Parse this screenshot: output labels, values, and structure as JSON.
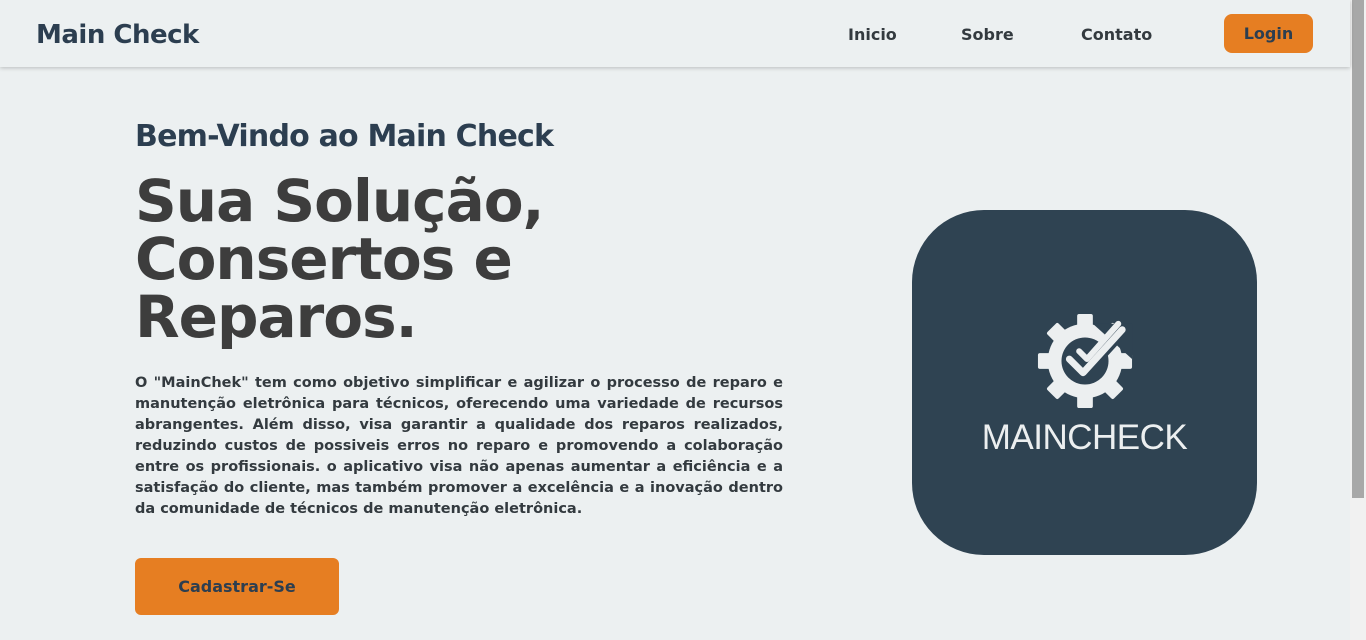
{
  "header": {
    "brand": "Main Check",
    "nav": [
      "Inicio",
      "Sobre",
      "Contato"
    ],
    "login_label": "Login"
  },
  "hero": {
    "welcome": "Bem-Vindo ao Main Check",
    "headline_lines": [
      "Sua Solução,",
      "Consertos e",
      "Reparos."
    ],
    "description": "O \"MainChek\" tem como objetivo simplificar e agilizar o processo de reparo e manutenção eletrônica para técnicos, oferecendo uma variedade de recursos abrangentes. Além disso, visa garantir a qualidade dos reparos realizados, reduzindo custos de possiveis erros no reparo e promovendo a colaboração entre os profissionais. o aplicativo visa não apenas aumentar a eficiência e a satisfação do cliente, mas também promover a excelência e a inovação dentro da comunidade de técnicos de manutenção eletrônica.",
    "signup_label": "Cadastrar-Se"
  },
  "logo": {
    "text": "MAINCHECK",
    "icon": "gear-check-icon"
  },
  "colors": {
    "background": "#ecf0f1",
    "accent": "#e67e22",
    "dark": "#2c3e50",
    "logo_bg": "#2f4352"
  }
}
